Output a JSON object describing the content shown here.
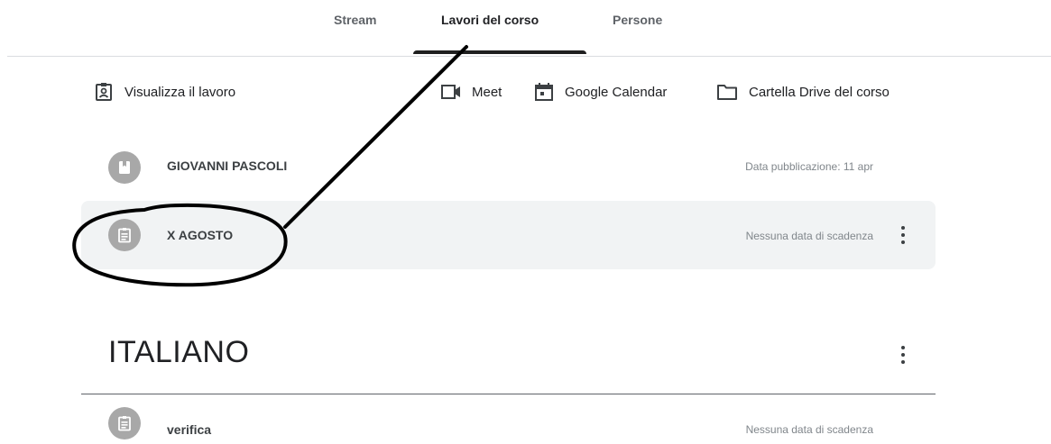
{
  "tabs": [
    {
      "label": "Stream",
      "active": false
    },
    {
      "label": "Lavori del corso",
      "active": true
    },
    {
      "label": "Persone",
      "active": false
    }
  ],
  "toolbar": {
    "view_work": "Visualizza il lavoro",
    "meet": "Meet",
    "calendar": "Google Calendar",
    "drive": "Cartella Drive del corso"
  },
  "items": [
    {
      "title": "GIOVANNI PASCOLI",
      "meta": "Data pubblicazione: 11 apr",
      "icon": "bookmark-icon"
    },
    {
      "title": "X AGOSTO",
      "meta": "Nessuna data di scadenza",
      "icon": "assignment-icon"
    }
  ],
  "section": {
    "title": "ITALIANO",
    "items": [
      {
        "title": "verifica",
        "meta": "Nessuna data di scadenza",
        "icon": "assignment-icon"
      }
    ]
  },
  "colors": {
    "icon_circle": "#a8a8a8",
    "row_highlight": "#f1f3f4",
    "annotation": "#000000"
  }
}
